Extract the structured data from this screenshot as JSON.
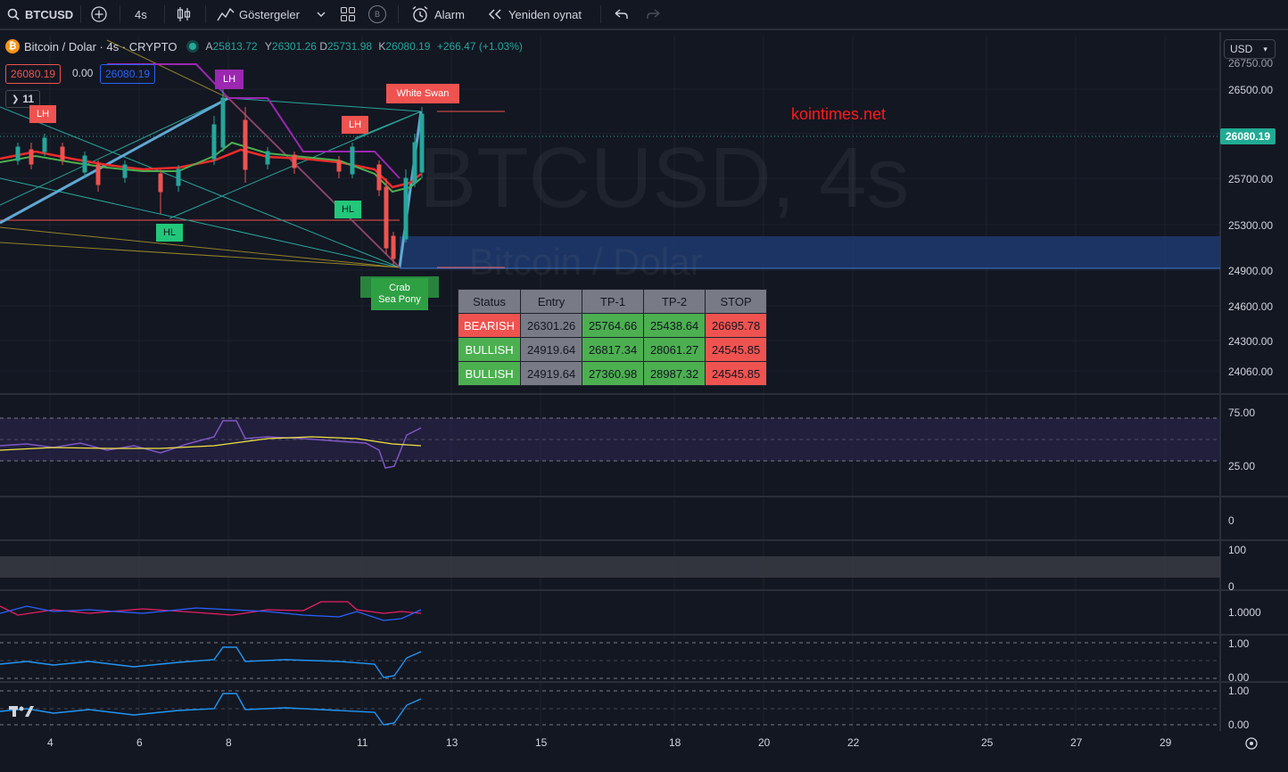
{
  "toolbar": {
    "symbol": "BTCUSD",
    "interval": "4s",
    "indicators_label": "Göstergeler",
    "alarm_label": "Alarm",
    "replay_label": "Yeniden oynat",
    "layout_badge": "B"
  },
  "legend": {
    "title": "Bitcoin / Dolar · 4s · CRYPTO",
    "o_label": "A",
    "o": "25813.72",
    "h_label": "Y",
    "h": "26301.26",
    "l_label": "D",
    "l": "25731.98",
    "c_label": "K",
    "c": "26080.19",
    "change": "+266.47 (+1.03%)",
    "sell_price": "26080.19",
    "spread": "0.00",
    "buy_price": "26080.19",
    "indicator_count": "11"
  },
  "currency": "USD",
  "price_axis": [
    "26500.00",
    "26080.19",
    "25700.00",
    "25300.00",
    "24900.00",
    "24600.00",
    "24300.00",
    "24060.00"
  ],
  "price_axis_top": "26750.00",
  "current_price": "26080.19",
  "rsi_axis": [
    "75.00",
    "25.00"
  ],
  "pane2_axis": [
    "0"
  ],
  "pane3_axis": [
    "100",
    "0"
  ],
  "pane4_axis": [
    "1.0000"
  ],
  "pane5_axis": [
    "1.00",
    "0.00"
  ],
  "pane6_axis": [
    "1.00",
    "0.00"
  ],
  "time_axis": [
    "4",
    "6",
    "8",
    "11",
    "13",
    "15",
    "18",
    "20",
    "22",
    "25",
    "27",
    "29"
  ],
  "watermark": {
    "symbol": "BTCUSD, 4s",
    "name": "Bitcoin / Dolar"
  },
  "kointimes": "kointimes.net",
  "labels": {
    "lh1": "LH",
    "lh2": "LH",
    "lh3": "LH",
    "hl1": "HL",
    "hl2": "HL",
    "white_swan": "White Swan",
    "crab": "Crab\nSea Pony"
  },
  "signal_table": {
    "headers": [
      "Status",
      "Entry",
      "TP-1",
      "TP-2",
      "STOP"
    ],
    "rows": [
      [
        "BEARISH",
        "26301.26",
        "25764.66",
        "25438.64",
        "26695.78"
      ],
      [
        "BULLISH",
        "24919.64",
        "26817.34",
        "28061.27",
        "24545.85"
      ],
      [
        "BULLISH",
        "24919.64",
        "27360.98",
        "28987.32",
        "24545.85"
      ]
    ]
  },
  "colors": {
    "up": "#26a69a",
    "down": "#ef5350",
    "accent": "#2962ff",
    "bg": "#131722"
  }
}
